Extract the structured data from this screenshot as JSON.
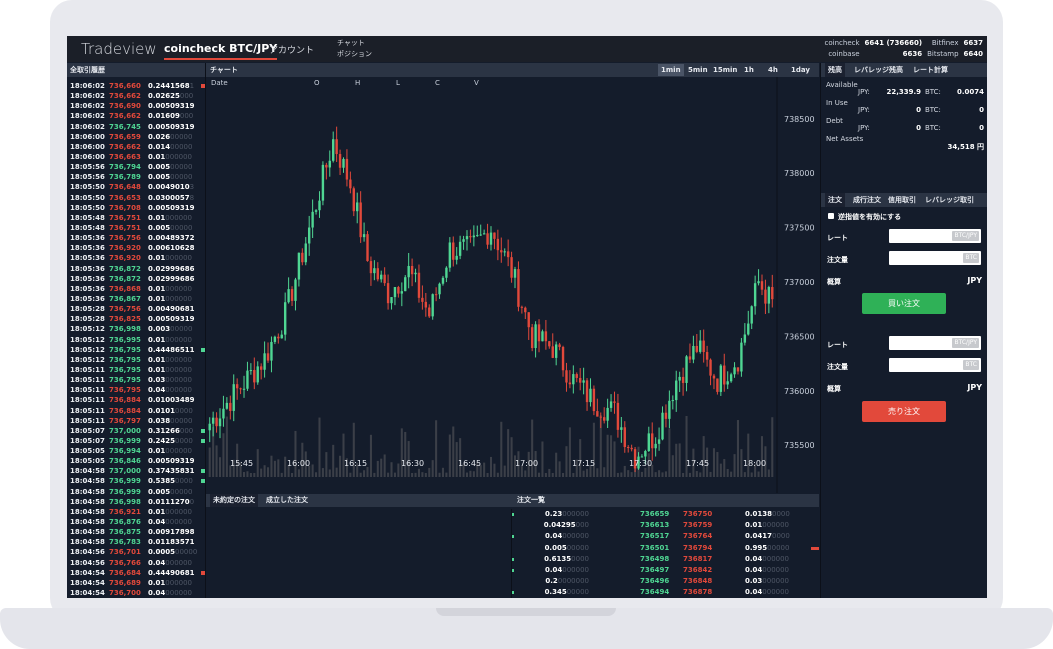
{
  "app": {
    "logo": "Tradeview",
    "pair": "coincheck BTC/JPY",
    "account": "アカウント",
    "menu": [
      "チャット",
      "ポジション"
    ]
  },
  "exchanges": [
    {
      "name": "coincheck",
      "value": "6641 (736660)",
      "name2": "Bitfinex",
      "value2": "6637"
    },
    {
      "name": "coinbase",
      "value": "6636",
      "name2": "Bitstamp",
      "value2": "6640"
    }
  ],
  "trade_history": {
    "title": "全取引履歴",
    "rows": [
      {
        "time": "18:06:02",
        "price": "736,660",
        "dir": "dn",
        "size": "0.2441568",
        "zeros": "1",
        "mark": "red"
      },
      {
        "time": "18:06:02",
        "price": "736,662",
        "dir": "dn",
        "size": "0.02625",
        "zeros": "000",
        "mark": ""
      },
      {
        "time": "18:06:02",
        "price": "736,690",
        "dir": "dn",
        "size": "0.00509319",
        "zeros": "",
        "mark": ""
      },
      {
        "time": "18:06:02",
        "price": "736,662",
        "dir": "dn",
        "size": "0.01609",
        "zeros": "000",
        "mark": ""
      },
      {
        "time": "18:06:02",
        "price": "736,745",
        "dir": "up",
        "size": "0.00509319",
        "zeros": "",
        "mark": ""
      },
      {
        "time": "18:06:00",
        "price": "736,659",
        "dir": "dn",
        "size": "0.026",
        "zeros": "00000",
        "mark": ""
      },
      {
        "time": "18:06:00",
        "price": "736,662",
        "dir": "dn",
        "size": "0.014",
        "zeros": "00000",
        "mark": ""
      },
      {
        "time": "18:06:00",
        "price": "736,663",
        "dir": "dn",
        "size": "0.01",
        "zeros": "000000",
        "mark": ""
      },
      {
        "time": "18:05:56",
        "price": "736,794",
        "dir": "up",
        "size": "0.005",
        "zeros": "00000",
        "mark": ""
      },
      {
        "time": "18:05:56",
        "price": "736,789",
        "dir": "up",
        "size": "0.005",
        "zeros": "00000",
        "mark": ""
      },
      {
        "time": "18:05:50",
        "price": "736,648",
        "dir": "dn",
        "size": "0.0049010",
        "zeros": "3",
        "mark": ""
      },
      {
        "time": "18:05:50",
        "price": "736,653",
        "dir": "dn",
        "size": "0.0300057",
        "zeros": "8",
        "mark": ""
      },
      {
        "time": "18:05:50",
        "price": "736,708",
        "dir": "dn",
        "size": "0.00509319",
        "zeros": "",
        "mark": ""
      },
      {
        "time": "18:05:48",
        "price": "736,751",
        "dir": "dn",
        "size": "0.01",
        "zeros": "000000",
        "mark": ""
      },
      {
        "time": "18:05:48",
        "price": "736,751",
        "dir": "dn",
        "size": "0.005",
        "zeros": "00000",
        "mark": ""
      },
      {
        "time": "18:05:36",
        "price": "736,756",
        "dir": "dn",
        "size": "0.00489372",
        "zeros": "",
        "mark": ""
      },
      {
        "time": "18:05:36",
        "price": "736,920",
        "dir": "dn",
        "size": "0.00610628",
        "zeros": "",
        "mark": ""
      },
      {
        "time": "18:05:36",
        "price": "736,920",
        "dir": "dn",
        "size": "0.01",
        "zeros": "000000",
        "mark": ""
      },
      {
        "time": "18:05:36",
        "price": "736,872",
        "dir": "up",
        "size": "0.02999686",
        "zeros": "",
        "mark": ""
      },
      {
        "time": "18:05:36",
        "price": "736,872",
        "dir": "up",
        "size": "0.02999686",
        "zeros": "",
        "mark": ""
      },
      {
        "time": "18:05:36",
        "price": "736,868",
        "dir": "dn",
        "size": "0.01",
        "zeros": "000000",
        "mark": ""
      },
      {
        "time": "18:05:36",
        "price": "736,867",
        "dir": "up",
        "size": "0.01",
        "zeros": "000000",
        "mark": ""
      },
      {
        "time": "18:05:28",
        "price": "736,756",
        "dir": "dn",
        "size": "0.00490681",
        "zeros": "",
        "mark": ""
      },
      {
        "time": "18:05:28",
        "price": "736,825",
        "dir": "dn",
        "size": "0.00509319",
        "zeros": "",
        "mark": ""
      },
      {
        "time": "18:05:12",
        "price": "736,998",
        "dir": "up",
        "size": "0.003",
        "zeros": "00000",
        "mark": ""
      },
      {
        "time": "18:05:12",
        "price": "736,995",
        "dir": "up",
        "size": "0.01",
        "zeros": "000000",
        "mark": ""
      },
      {
        "time": "18:05:12",
        "price": "736,795",
        "dir": "up",
        "size": "0.44486511",
        "zeros": "",
        "mark": "green"
      },
      {
        "time": "18:05:12",
        "price": "736,795",
        "dir": "up",
        "size": "0.01",
        "zeros": "000000",
        "mark": ""
      },
      {
        "time": "18:05:11",
        "price": "736,795",
        "dir": "up",
        "size": "0.01",
        "zeros": "000000",
        "mark": ""
      },
      {
        "time": "18:05:11",
        "price": "736,795",
        "dir": "up",
        "size": "0.03",
        "zeros": "000000",
        "mark": ""
      },
      {
        "time": "18:05:11",
        "price": "736,795",
        "dir": "dn",
        "size": "0.04",
        "zeros": "000000",
        "mark": ""
      },
      {
        "time": "18:05:11",
        "price": "736,884",
        "dir": "dn",
        "size": "0.01003489",
        "zeros": "",
        "mark": ""
      },
      {
        "time": "18:05:11",
        "price": "736,884",
        "dir": "dn",
        "size": "0.0101",
        "zeros": "0000",
        "mark": ""
      },
      {
        "time": "18:05:11",
        "price": "736,797",
        "dir": "dn",
        "size": "0.038",
        "zeros": "00000",
        "mark": ""
      },
      {
        "time": "18:05:07",
        "price": "737,000",
        "dir": "up",
        "size": "0.31266",
        "zeros": "000",
        "mark": "green"
      },
      {
        "time": "18:05:07",
        "price": "736,999",
        "dir": "up",
        "size": "0.2425",
        "zeros": "0000",
        "mark": "green"
      },
      {
        "time": "18:05:05",
        "price": "736,994",
        "dir": "up",
        "size": "0.01",
        "zeros": "000000",
        "mark": ""
      },
      {
        "time": "18:05:05",
        "price": "736,846",
        "dir": "up",
        "size": "0.00509319",
        "zeros": "",
        "mark": ""
      },
      {
        "time": "18:04:58",
        "price": "737,000",
        "dir": "up",
        "size": "0.37435831",
        "zeros": "",
        "mark": "green"
      },
      {
        "time": "18:04:58",
        "price": "736,999",
        "dir": "up",
        "size": "0.5385",
        "zeros": "0000",
        "mark": "green"
      },
      {
        "time": "18:04:58",
        "price": "736,999",
        "dir": "up",
        "size": "0.005",
        "zeros": "00000",
        "mark": ""
      },
      {
        "time": "18:04:58",
        "price": "736,998",
        "dir": "up",
        "size": "0.0111270",
        "zeros": "0",
        "mark": ""
      },
      {
        "time": "18:04:58",
        "price": "736,921",
        "dir": "dn",
        "size": "0.01",
        "zeros": "000000",
        "mark": ""
      },
      {
        "time": "18:04:58",
        "price": "736,876",
        "dir": "up",
        "size": "0.04",
        "zeros": "000000",
        "mark": ""
      },
      {
        "time": "18:04:58",
        "price": "736,875",
        "dir": "up",
        "size": "0.00917898",
        "zeros": "",
        "mark": ""
      },
      {
        "time": "18:04:58",
        "price": "736,783",
        "dir": "up",
        "size": "0.01183571",
        "zeros": "",
        "mark": ""
      },
      {
        "time": "18:04:56",
        "price": "736,701",
        "dir": "dn",
        "size": "0.0005",
        "zeros": "00000",
        "mark": ""
      },
      {
        "time": "18:04:56",
        "price": "736,766",
        "dir": "dn",
        "size": "0.04",
        "zeros": "000000",
        "mark": ""
      },
      {
        "time": "18:04:54",
        "price": "736,684",
        "dir": "dn",
        "size": "0.44490681",
        "zeros": "",
        "mark": "red"
      },
      {
        "time": "18:04:54",
        "price": "736,689",
        "dir": "dn",
        "size": "0.01",
        "zeros": "000000",
        "mark": ""
      },
      {
        "time": "18:04:54",
        "price": "736,700",
        "dir": "dn",
        "size": "0.04",
        "zeros": "000000",
        "mark": ""
      }
    ]
  },
  "chart": {
    "title": "チャート",
    "timeframes": [
      "1min",
      "5min",
      "15min",
      "1h",
      "4h",
      "1day"
    ],
    "active_timeframe": "1min",
    "ohlc_labels": [
      "Date",
      "O",
      "H",
      "L",
      "C",
      "V"
    ]
  },
  "chart_data": {
    "type": "candlestick",
    "x_ticks": [
      "15:45",
      "16:00",
      "16:15",
      "16:30",
      "16:45",
      "17:00",
      "17:15",
      "17:30",
      "17:45",
      "18:00"
    ],
    "y_ticks": [
      738500,
      738000,
      737500,
      737000,
      736500,
      736000,
      735500
    ],
    "ylim": [
      735300,
      738700
    ],
    "keypoints": [
      [
        0,
        735700
      ],
      [
        8,
        736000
      ],
      [
        16,
        736300
      ],
      [
        22,
        736700
      ],
      [
        30,
        737600
      ],
      [
        36,
        738300
      ],
      [
        41,
        737900
      ],
      [
        46,
        737200
      ],
      [
        52,
        736900
      ],
      [
        58,
        737100
      ],
      [
        64,
        736700
      ],
      [
        70,
        737300
      ],
      [
        76,
        737300
      ],
      [
        82,
        737500
      ],
      [
        88,
        737100
      ],
      [
        94,
        736500
      ],
      [
        100,
        736400
      ],
      [
        106,
        736100
      ],
      [
        112,
        735900
      ],
      [
        118,
        735800
      ],
      [
        124,
        735400
      ],
      [
        130,
        735600
      ],
      [
        136,
        736100
      ],
      [
        142,
        736400
      ],
      [
        148,
        736100
      ],
      [
        154,
        736300
      ],
      [
        160,
        737000
      ],
      [
        164,
        736800
      ]
    ],
    "volume_max": 60
  },
  "orders": {
    "tabs": [
      "未約定の注文",
      "成立した注文"
    ],
    "active": 0
  },
  "order_book": {
    "title": "注文一覧",
    "rows": [
      {
        "size1": "0.23",
        "z1": "000000",
        "p1": "736659",
        "p2": "736750",
        "size2": "0.0138",
        "z2": "0000",
        "m1": true,
        "m2": false
      },
      {
        "size1": "0.04295",
        "z1": "000",
        "p1": "736613",
        "p2": "736759",
        "size2": "0.01",
        "z2": "000000",
        "m1": false,
        "m2": false
      },
      {
        "size1": "0.04",
        "z1": "000000",
        "p1": "736517",
        "p2": "736764",
        "size2": "0.0417",
        "z2": "0000",
        "m1": true,
        "m2": false
      },
      {
        "size1": "0.005",
        "z1": "00000",
        "p1": "736501",
        "p2": "736794",
        "size2": "0.995",
        "z2": "00000",
        "m1": false,
        "m2": true
      },
      {
        "size1": "0.6135",
        "z1": "0000",
        "p1": "736498",
        "p2": "736817",
        "size2": "0.04",
        "z2": "000000",
        "m1": true,
        "m2": false
      },
      {
        "size1": "0.04",
        "z1": "000000",
        "p1": "736497",
        "p2": "736842",
        "size2": "0.04",
        "z2": "000000",
        "m1": true,
        "m2": false
      },
      {
        "size1": "0.2",
        "z1": "0000000",
        "p1": "736496",
        "p2": "736848",
        "size2": "0.03",
        "z2": "000000",
        "m1": false,
        "m2": false
      },
      {
        "size1": "0.345",
        "z1": "00000",
        "p1": "736494",
        "p2": "736878",
        "size2": "0.04",
        "z2": "000000",
        "m1": true,
        "m2": false
      }
    ]
  },
  "balance": {
    "tabs": [
      "残高",
      "レバレッジ残高",
      "レート計算"
    ],
    "available_label": "Available",
    "in_use_label": "In Use",
    "debt_label": "Debt",
    "net_assets_label": "Net Assets",
    "available": {
      "jpy_label": "JPY:",
      "jpy": "22,339.9",
      "btc_label": "BTC:",
      "btc": "0.0074"
    },
    "in_use": {
      "jpy_label": "JPY:",
      "jpy": "0",
      "btc_label": "BTC:",
      "btc": "0"
    },
    "debt": {
      "jpy_label": "JPY:",
      "jpy": "0",
      "btc_label": "BTC:",
      "btc": "0"
    },
    "net_assets": "34,518 円"
  },
  "order_form": {
    "tabs": [
      "注文",
      "成行注文",
      "信用取引",
      "レバレッジ取引"
    ],
    "checkbox_label": "逆指値を有効にする",
    "rate_label": "レート",
    "amount_label": "注文量",
    "estimate_label": "概算",
    "rate_unit": "BTC/JPY",
    "amount_unit": "BTC",
    "currency": "JPY",
    "buy_label": "買い注文",
    "sell_label": "売り注文"
  },
  "colors": {
    "up": "#4fd693",
    "down": "#e2493b",
    "panel": "#141c2b",
    "buy": "#2fb157",
    "sell": "#e2493b"
  }
}
